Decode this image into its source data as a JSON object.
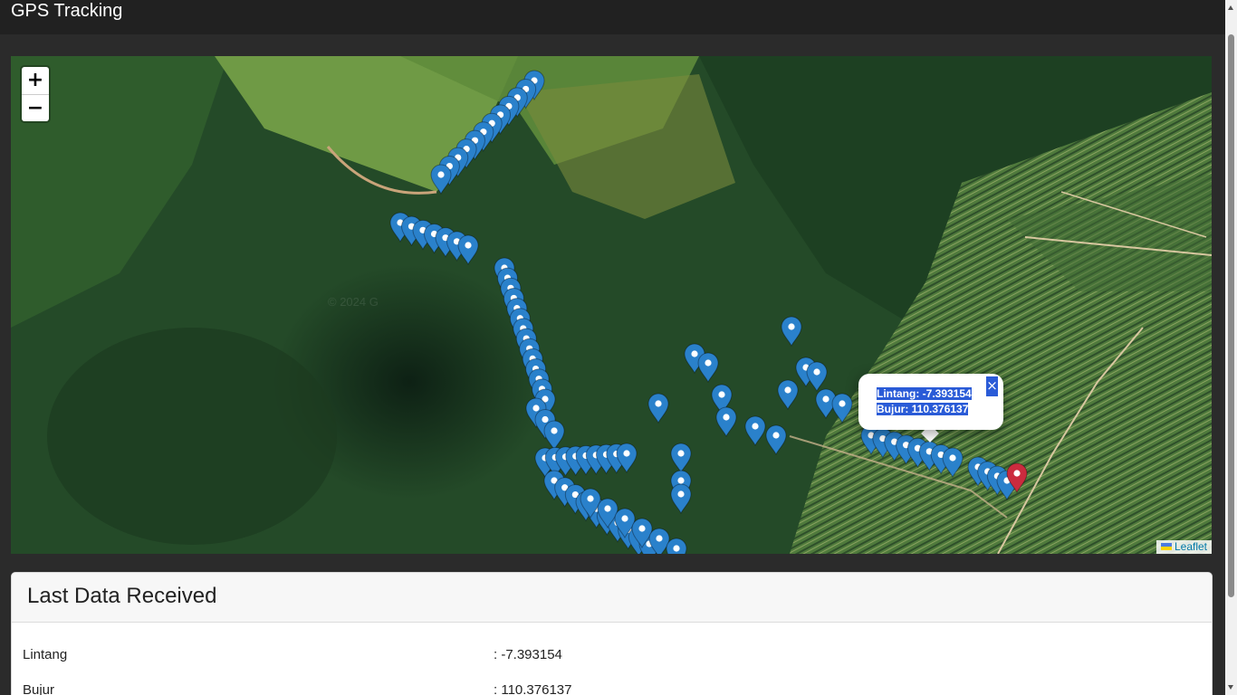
{
  "navbar": {
    "title": "GPS Tracking"
  },
  "map": {
    "zoom_in": "+",
    "zoom_out": "−",
    "attribution": "Leaflet",
    "watermark": "© 2024 G",
    "popup": {
      "latitude_text": "Lintang: -7.393154",
      "longitude_text": "Bujur: 110.376137",
      "close": "×"
    },
    "marker_colors": {
      "history": "#2a81cb",
      "latest": "#cb2b3e"
    }
  },
  "last_data": {
    "title": "Last Data Received",
    "rows": [
      {
        "label": "Lintang",
        "value": ": -7.393154"
      },
      {
        "label": "Bujur",
        "value": ": 110.376137"
      }
    ]
  }
}
